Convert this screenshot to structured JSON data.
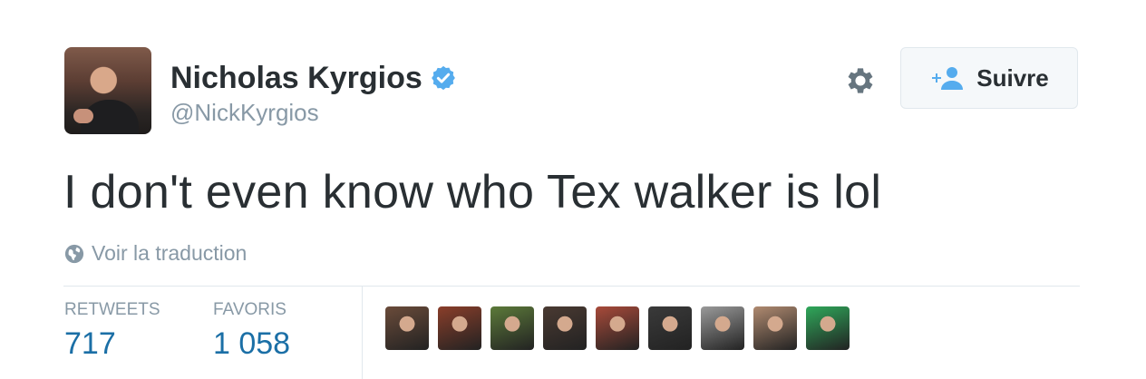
{
  "user": {
    "display_name": "Nicholas Kyrgios",
    "handle": "@NickKyrgios",
    "verified": true
  },
  "follow_button": {
    "label": "Suivre"
  },
  "tweet": {
    "text": "I don't even know who Tex walker is lol",
    "translate_label": "Voir la traduction"
  },
  "stats": {
    "retweets_label": "RETWEETS",
    "retweets_value": "717",
    "favorites_label": "FAVORIS",
    "favorites_value": "1 058"
  },
  "colors": {
    "text": "#292f33",
    "muted": "#8899a6",
    "stat_value": "#1b6fa6",
    "verified": "#55acee",
    "follow_icon": "#55acee"
  },
  "favoriters": [
    {
      "name": "favoriter-1",
      "bg": "#6a4b3a"
    },
    {
      "name": "favoriter-2",
      "bg": "#8a3e2a"
    },
    {
      "name": "favoriter-3",
      "bg": "#5c7a3a"
    },
    {
      "name": "favoriter-4",
      "bg": "#4a3a32"
    },
    {
      "name": "favoriter-5",
      "bg": "#a84a3a"
    },
    {
      "name": "favoriter-6",
      "bg": "#3a3a3a"
    },
    {
      "name": "favoriter-7",
      "bg": "#9a9a9a"
    },
    {
      "name": "favoriter-8",
      "bg": "#b08a70"
    },
    {
      "name": "favoriter-9",
      "bg": "#2fa85a"
    }
  ]
}
